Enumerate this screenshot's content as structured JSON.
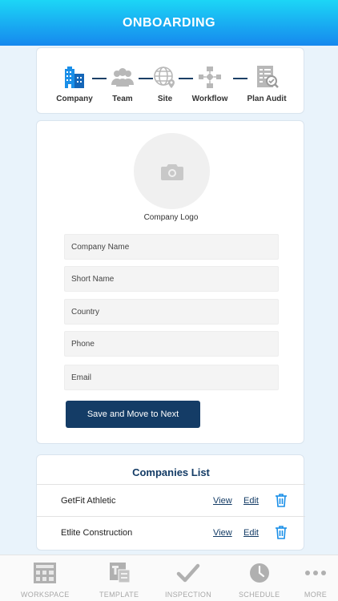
{
  "header": {
    "title": "ONBOARDING"
  },
  "steps": [
    {
      "label": "Company",
      "icon": "building-icon",
      "active": true
    },
    {
      "label": "Team",
      "icon": "team-icon",
      "active": false
    },
    {
      "label": "Site",
      "icon": "globe-pin-icon",
      "active": false
    },
    {
      "label": "Workflow",
      "icon": "workflow-icon",
      "active": false
    },
    {
      "label": "Plan Audit",
      "icon": "audit-icon",
      "active": false
    }
  ],
  "form": {
    "logo_caption": "Company Logo",
    "fields": {
      "company_name": {
        "placeholder": "Company Name",
        "value": ""
      },
      "short_name": {
        "placeholder": "Short Name",
        "value": ""
      },
      "country": {
        "placeholder": "Country",
        "value": ""
      },
      "phone": {
        "placeholder": "Phone",
        "value": ""
      },
      "email": {
        "placeholder": "Email",
        "value": ""
      }
    },
    "submit_label": "Save and Move to Next"
  },
  "companies": {
    "title": "Companies List",
    "view_label": "View",
    "edit_label": "Edit",
    "rows": [
      {
        "name": "GetFit Athletic"
      },
      {
        "name": "Etlite Construction"
      }
    ]
  },
  "nav": [
    {
      "label": "WORKSPACE",
      "icon": "workspace-icon"
    },
    {
      "label": "TEMPLATE",
      "icon": "template-icon"
    },
    {
      "label": "INSPECTION",
      "icon": "checkmark-icon"
    },
    {
      "label": "SCHEDULE",
      "icon": "clock-icon"
    },
    {
      "label": "MORE",
      "icon": "more-dots-icon"
    }
  ],
  "colors": {
    "header_gradient_top": "#1cd6f6",
    "header_gradient_bottom": "#1688ee",
    "primary_dark": "#143c66",
    "active_step": "#1a8fe8",
    "inactive_icon": "#b8b8b8",
    "trash": "#1a8fe8"
  }
}
